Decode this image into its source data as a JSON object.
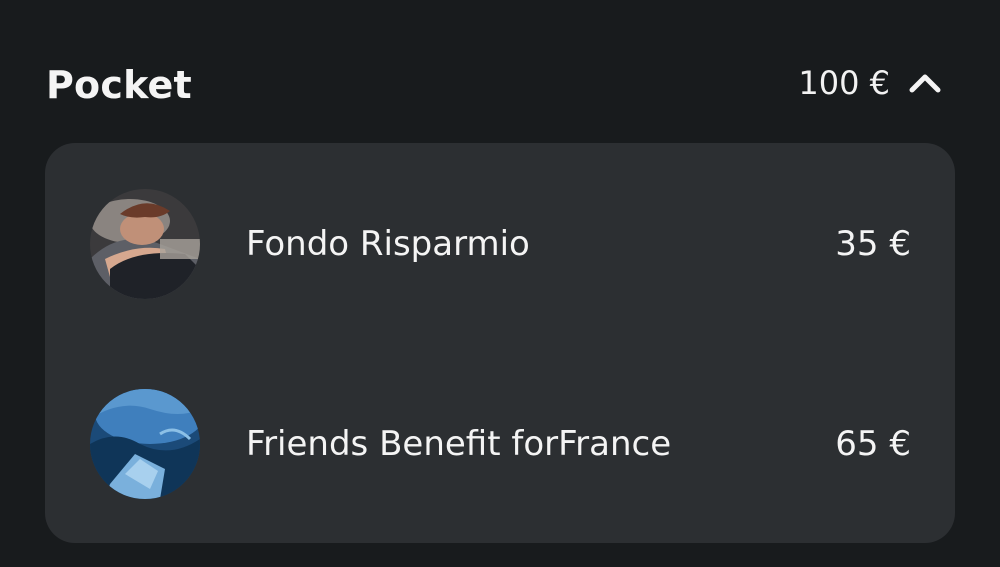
{
  "pocket": {
    "title": "Pocket",
    "total": "100 €",
    "toggle_icon": "chevron-up-icon",
    "items": [
      {
        "name": "Fondo Risparmio",
        "amount": "35 €",
        "avatar_icon": "person-photo-avatar"
      },
      {
        "name": "Friends Benefit forFrance",
        "amount": "65 €",
        "avatar_icon": "ice-photo-avatar"
      }
    ]
  },
  "colors": {
    "background": "#181b1d",
    "card": "#2c2f32",
    "text": "#f4f4f4"
  }
}
